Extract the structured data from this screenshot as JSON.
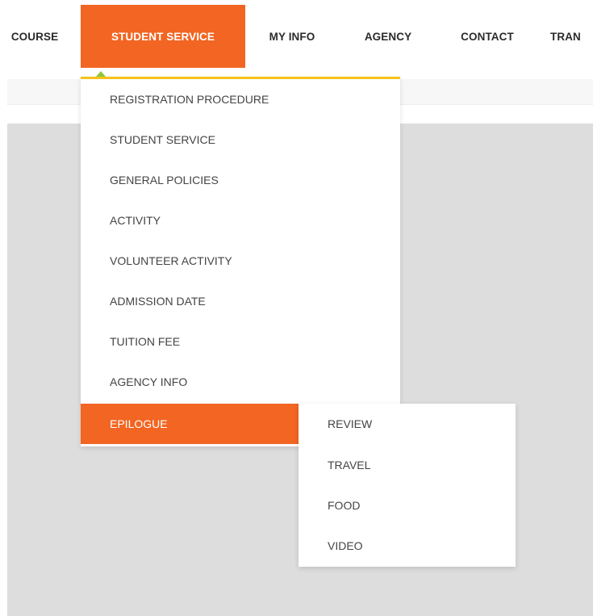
{
  "nav": {
    "items": [
      {
        "label": "COURSE"
      },
      {
        "label": "STUDENT SERVICE"
      },
      {
        "label": "MY INFO"
      },
      {
        "label": "AGENCY"
      },
      {
        "label": "CONTACT"
      },
      {
        "label": "TRAN"
      }
    ],
    "active_index": 1
  },
  "dropdown": {
    "items": [
      {
        "label": "REGISTRATION PROCEDURE"
      },
      {
        "label": "STUDENT SERVICE"
      },
      {
        "label": "GENERAL POLICIES"
      },
      {
        "label": "ACTIVITY"
      },
      {
        "label": "VOLUNTEER ACTIVITY"
      },
      {
        "label": "ADMISSION DATE"
      },
      {
        "label": "TUITION FEE"
      },
      {
        "label": "AGENCY INFO"
      },
      {
        "label": "EPILOGUE"
      }
    ],
    "active_index": 8
  },
  "submenu": {
    "items": [
      {
        "label": "REVIEW"
      },
      {
        "label": "TRAVEL"
      },
      {
        "label": "FOOD"
      },
      {
        "label": "VIDEO"
      }
    ]
  },
  "colors": {
    "accent_orange": "#f26522",
    "dropdown_top_border": "#f7c21a",
    "caret_green": "#8cc63f",
    "content_gray": "#dddddd"
  }
}
